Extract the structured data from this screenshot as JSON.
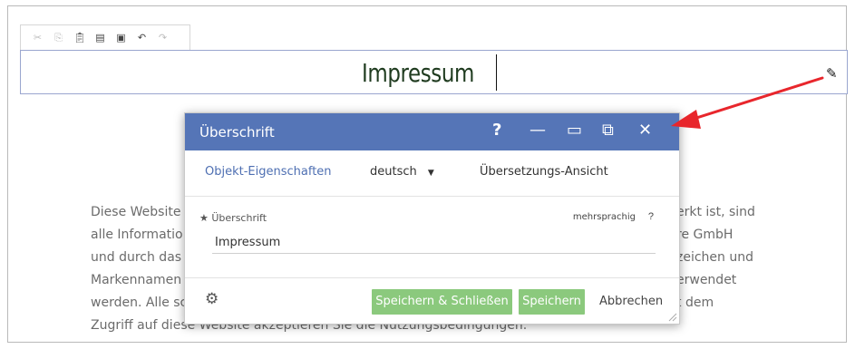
{
  "toolbar": {
    "icons": [
      "cut-icon",
      "copy-icon",
      "paste-icon",
      "paste-text-icon",
      "paste-word-icon",
      "undo-icon",
      "redo-icon"
    ]
  },
  "heading": {
    "text": "Impressum"
  },
  "body": {
    "lines": [
      "Diese Website",
      "erkt ist, sind",
      "alle Informatio",
      "re GmbH",
      "und durch das",
      "zeichen und",
      "Markennamen",
      "erwendet",
      "werden. Alle sc",
      "t dem",
      "Zugriff auf diese Website akzeptieren Sie die Nutzungsbedingungen."
    ]
  },
  "dialog": {
    "title": "Überschrift",
    "controls": {
      "help": "?",
      "minimize": "—",
      "maximize": "▭",
      "restore": "⧉",
      "close": "✕"
    },
    "tabs": {
      "properties": "Objekt-Eigenschaften",
      "language": "deutsch",
      "translation": "Übersetzungs-Ansicht"
    },
    "field": {
      "label": "Überschrift",
      "multilingual": "mehrsprachig",
      "help": "?",
      "value": "Impressum"
    },
    "buttons": {
      "save_close": "Speichern & Schließen",
      "save": "Speichern",
      "cancel": "Abbrechen"
    }
  },
  "colors": {
    "header_bg": "#5575b7",
    "active_tab": "#4e6fb2",
    "button_green": "#8bc97d",
    "arrow_red": "#e8262c"
  }
}
